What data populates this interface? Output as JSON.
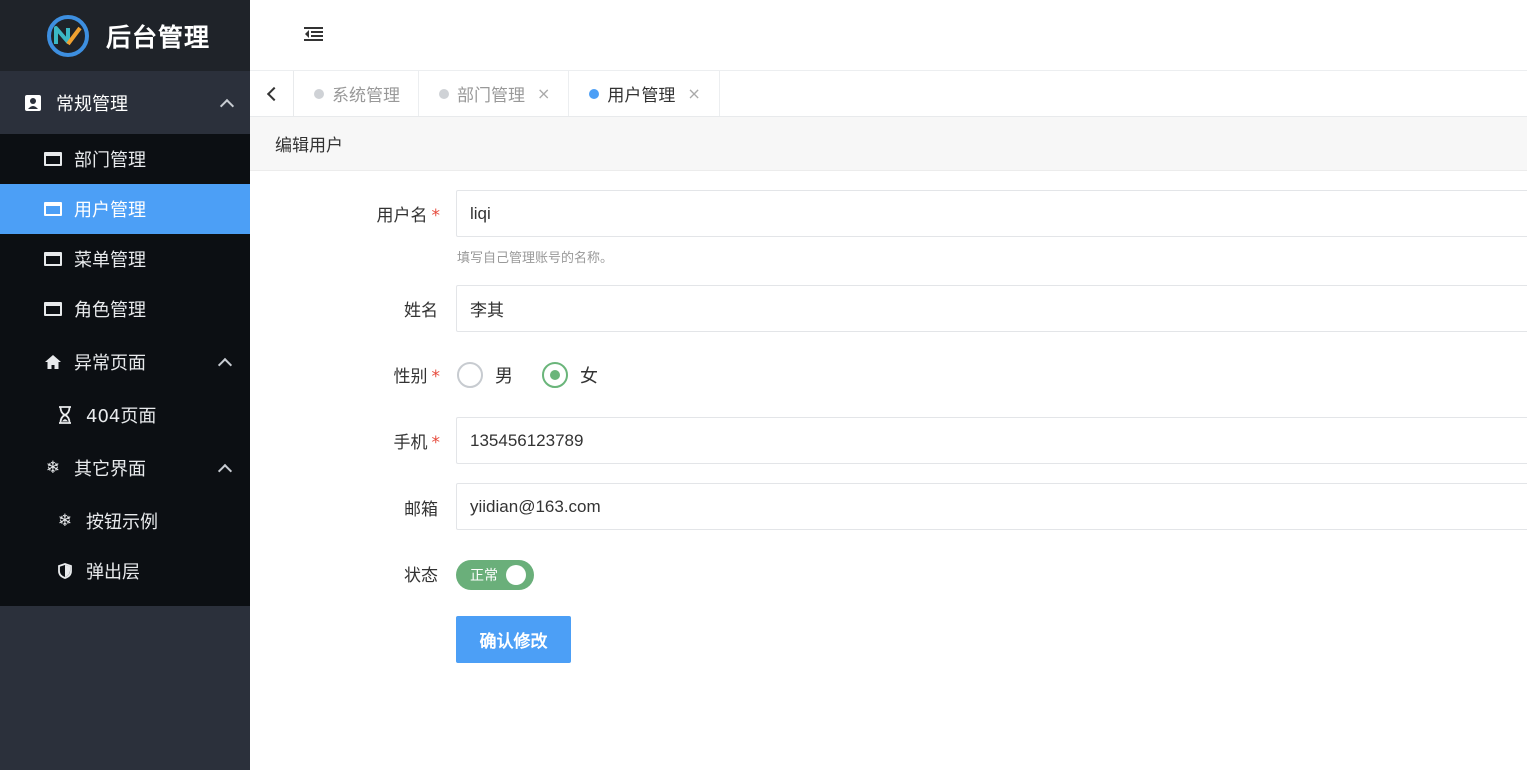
{
  "app": {
    "title": "后台管理"
  },
  "sidebar": {
    "group": {
      "label": "常规管理",
      "icon": "contact-card-icon"
    },
    "items": [
      {
        "label": "部门管理",
        "icon": "window-icon"
      },
      {
        "label": "用户管理",
        "icon": "window-icon",
        "active": true
      },
      {
        "label": "菜单管理",
        "icon": "window-icon"
      },
      {
        "label": "角色管理",
        "icon": "window-icon"
      }
    ],
    "error_group": {
      "label": "异常页面",
      "icon": "home-icon",
      "children": [
        {
          "label": "404页面",
          "icon": "hourglass-icon"
        }
      ]
    },
    "other_group": {
      "label": "其它界面",
      "icon": "snowflake-icon",
      "children": [
        {
          "label": "按钮示例",
          "icon": "snowflake-icon"
        },
        {
          "label": "弹出层",
          "icon": "shield-icon"
        }
      ]
    }
  },
  "tabs": [
    {
      "label": "系统管理",
      "closable": false,
      "active": false
    },
    {
      "label": "部门管理",
      "closable": true,
      "active": false
    },
    {
      "label": "用户管理",
      "closable": true,
      "active": true
    }
  ],
  "tab_close_glyph": "×",
  "card": {
    "title": "编辑用户"
  },
  "form": {
    "username": {
      "label": "用户名",
      "value": "liqi",
      "hint": "填写自己管理账号的名称。",
      "required": true
    },
    "name": {
      "label": "姓名",
      "value": "李其"
    },
    "gender": {
      "label": "性别",
      "required": true,
      "options": [
        "男",
        "女"
      ],
      "selected": "女"
    },
    "phone": {
      "label": "手机",
      "value": "135456123789",
      "required": true
    },
    "email": {
      "label": "邮箱",
      "value": "yiidian@163.com"
    },
    "status": {
      "label": "状态",
      "value": "正常",
      "on": true
    },
    "submit_label": "确认修改",
    "required_mark": "*"
  },
  "colors": {
    "accent": "#4c9ff6",
    "success": "#6ab57a",
    "sidebar_bg": "#2b303b",
    "submenu_bg": "#0c0f13"
  }
}
